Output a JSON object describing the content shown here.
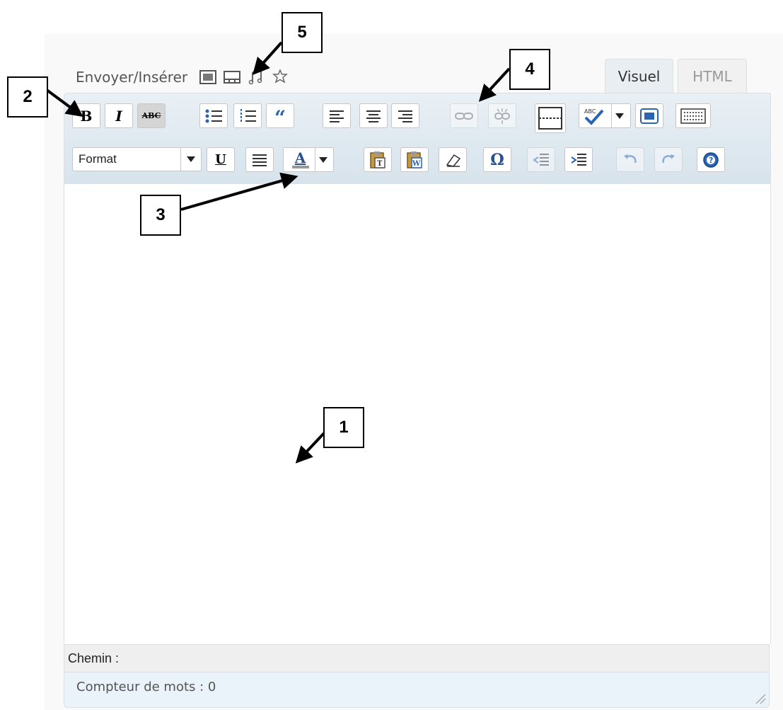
{
  "upload": {
    "label": "Envoyer/Insérer",
    "icons": [
      "image-upload-icon",
      "video-upload-icon",
      "audio-upload-icon",
      "media-upload-icon"
    ]
  },
  "tabs": {
    "visual": "Visuel",
    "html": "HTML"
  },
  "toolbar": {
    "bold": "B",
    "italic": "I",
    "strikethrough": "ABC",
    "blockquote": "“",
    "underline": "U",
    "format_select": "Format",
    "text_color": "A",
    "special_char": "Ω"
  },
  "path_bar": {
    "label": "Chemin :"
  },
  "word_count": {
    "label": "Compteur de mots : 0"
  },
  "callouts": [
    "1",
    "2",
    "3",
    "4",
    "5"
  ],
  "colors": {
    "toolbar_bg": "#dde8f0",
    "word_count_bg": "#eaf2fa",
    "visual_tab_bg": "#e9eef3",
    "text_color_bar": "#999999"
  }
}
